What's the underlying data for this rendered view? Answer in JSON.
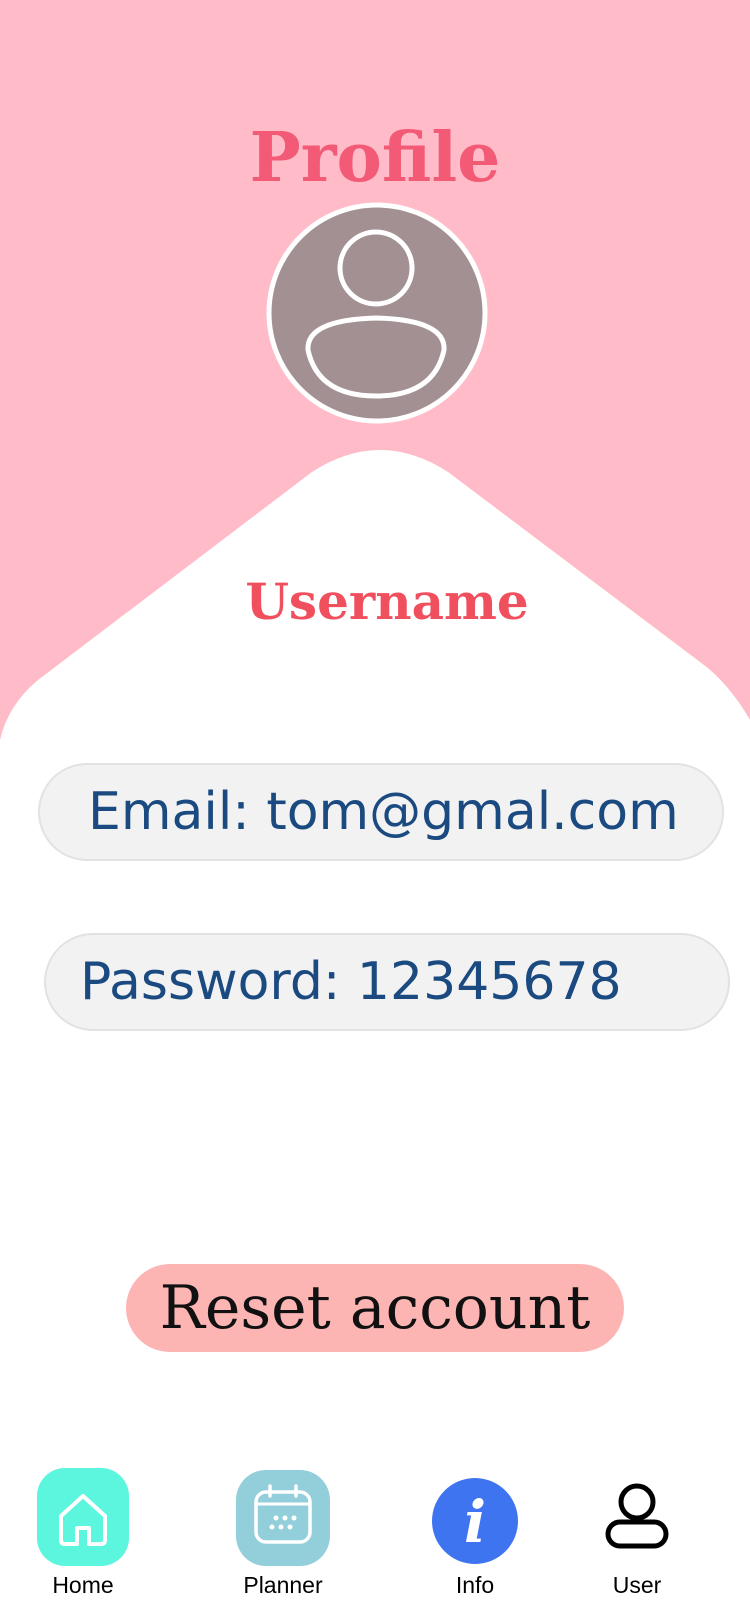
{
  "header": {
    "title": "Profile"
  },
  "profile": {
    "username": "Username",
    "email_text": "Email: tom@gmal.com",
    "password_text": "Password:  12345678"
  },
  "actions": {
    "reset_label": "Reset account"
  },
  "nav": {
    "items": [
      {
        "label": "Home",
        "icon": "home-icon",
        "color": "#5cf5dd"
      },
      {
        "label": "Planner",
        "icon": "calendar-icon",
        "color": "#93cfdb"
      },
      {
        "label": "Info",
        "icon": "info-icon",
        "color": "#3f74f0"
      },
      {
        "label": "User",
        "icon": "user-icon",
        "color": "#000000"
      }
    ]
  },
  "colors": {
    "header_bg": "#ffbcc8",
    "title": "#f25a76",
    "username": "#f0505e",
    "field_text": "#1a4a80",
    "field_bg": "#f2f2f3",
    "reset_bg": "#fdb5b4",
    "avatar_bg": "#a39092"
  }
}
